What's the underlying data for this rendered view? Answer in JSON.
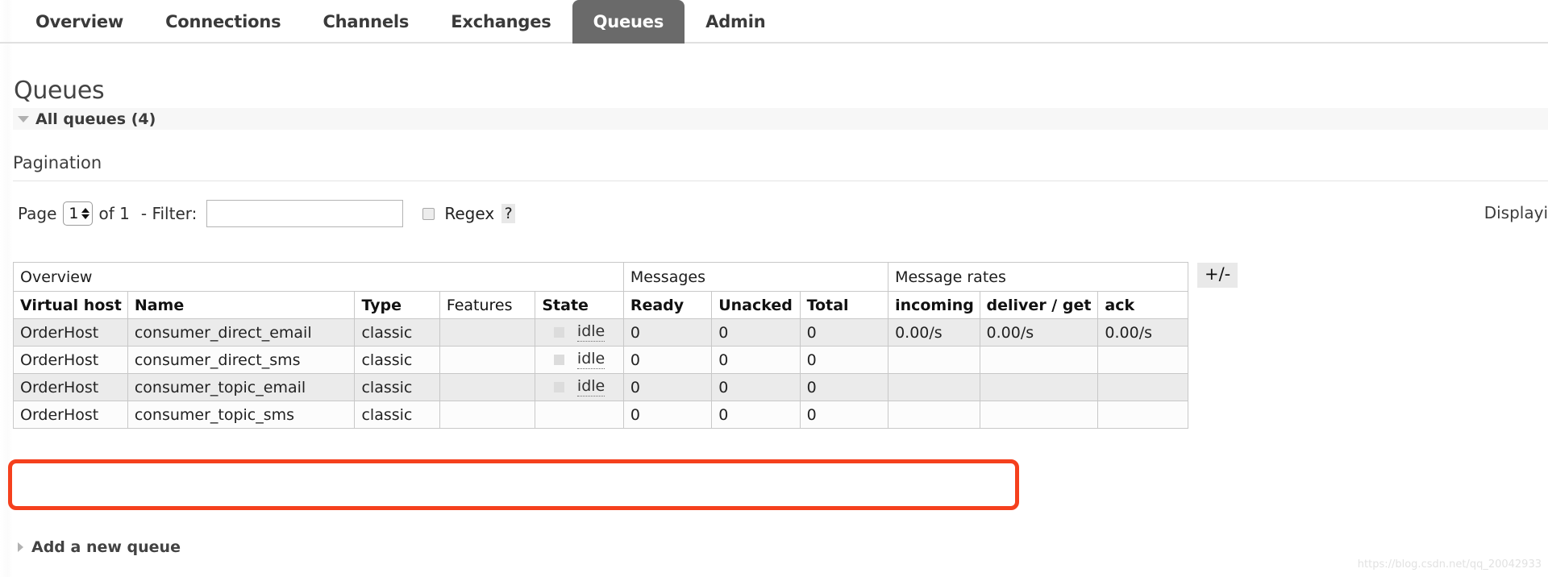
{
  "nav": {
    "tabs": [
      {
        "label": "Overview",
        "active": false
      },
      {
        "label": "Connections",
        "active": false
      },
      {
        "label": "Channels",
        "active": false
      },
      {
        "label": "Exchanges",
        "active": false
      },
      {
        "label": "Queues",
        "active": true
      },
      {
        "label": "Admin",
        "active": false
      }
    ]
  },
  "page": {
    "title": "Queues",
    "section_label": "All queues (4)",
    "pagination_heading": "Pagination",
    "add_queue_label": "Add a new queue",
    "watermark": "https://blog.csdn.net/qq_20042933"
  },
  "filter": {
    "page_label": "Page",
    "page_value": "1",
    "of_label": "of 1",
    "dash_filter_label": "- Filter:",
    "filter_value": "",
    "filter_placeholder": "",
    "regex_label": "Regex",
    "regex_checked": false,
    "help_label": "?",
    "displaying": "Displayi"
  },
  "table": {
    "toggle_columns_label": "+/-",
    "group_headers": [
      {
        "label": "Overview",
        "span": 5
      },
      {
        "label": "Messages",
        "span": 3
      },
      {
        "label": "Message rates",
        "span": 3
      }
    ],
    "columns": [
      {
        "label": "Virtual host",
        "bold": true,
        "align": "left"
      },
      {
        "label": "Name",
        "bold": true,
        "align": "left"
      },
      {
        "label": "Type",
        "bold": true,
        "align": "left"
      },
      {
        "label": "Features",
        "bold": false,
        "align": "left"
      },
      {
        "label": "State",
        "bold": true,
        "align": "left"
      },
      {
        "label": "Ready",
        "bold": true,
        "align": "right"
      },
      {
        "label": "Unacked",
        "bold": true,
        "align": "right"
      },
      {
        "label": "Total",
        "bold": true,
        "align": "right"
      },
      {
        "label": "incoming",
        "bold": true,
        "align": "right"
      },
      {
        "label": "deliver / get",
        "bold": true,
        "align": "right"
      },
      {
        "label": "ack",
        "bold": true,
        "align": "right"
      }
    ],
    "rows": [
      {
        "vhost": "OrderHost",
        "name": "consumer_direct_email",
        "type": "classic",
        "features": "",
        "state": "idle",
        "ready": "0",
        "unacked": "0",
        "total": "0",
        "incoming": "0.00/s",
        "deliver_get": "0.00/s",
        "ack": "0.00/s",
        "highlighted": false
      },
      {
        "vhost": "OrderHost",
        "name": "consumer_direct_sms",
        "type": "classic",
        "features": "",
        "state": "idle",
        "ready": "0",
        "unacked": "0",
        "total": "0",
        "incoming": "",
        "deliver_get": "",
        "ack": "",
        "highlighted": false
      },
      {
        "vhost": "OrderHost",
        "name": "consumer_topic_email",
        "type": "classic",
        "features": "",
        "state": "idle",
        "ready": "0",
        "unacked": "0",
        "total": "0",
        "incoming": "",
        "deliver_get": "",
        "ack": "",
        "highlighted": true
      },
      {
        "vhost": "OrderHost",
        "name": "consumer_topic_sms",
        "type": "classic",
        "features": "",
        "state": "",
        "ready": "0",
        "unacked": "0",
        "total": "0",
        "incoming": "",
        "deliver_get": "",
        "ack": "",
        "highlighted": true
      }
    ]
  },
  "annotation": {
    "highlight_color": "#f5401d"
  }
}
